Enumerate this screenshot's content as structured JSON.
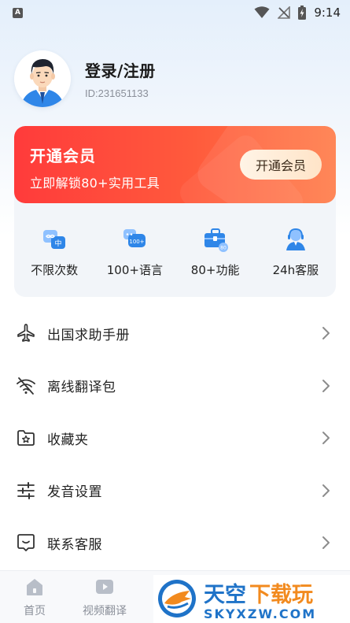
{
  "status_bar": {
    "left_icon": "A",
    "time": "9:14",
    "icons": [
      "wifi-icon",
      "no-signal-icon",
      "battery-charging-icon"
    ]
  },
  "profile": {
    "name": "登录/注册",
    "user_id": "ID:231651133",
    "avatar": "avatar-male-icon"
  },
  "vip": {
    "title": "开通会员",
    "subtitle": "立即解锁80+实用工具",
    "button_label": "开通会员",
    "gradient_start": "#ff3b3b",
    "gradient_end": "#ff7d4a",
    "features": [
      {
        "label": "不限次数",
        "icon": "infinity-translate-icon"
      },
      {
        "label": "100+语言",
        "icon": "language-chat-icon"
      },
      {
        "label": "80+功能",
        "icon": "toolbox-icon"
      },
      {
        "label": "24h客服",
        "icon": "customer-service-icon"
      }
    ]
  },
  "menu": [
    {
      "label": "出国求助手册",
      "icon": "airplane-icon"
    },
    {
      "label": "离线翻译包",
      "icon": "offline-wifi-icon"
    },
    {
      "label": "收藏夹",
      "icon": "star-folder-icon"
    },
    {
      "label": "发音设置",
      "icon": "sliders-icon"
    },
    {
      "label": "联系客服",
      "icon": "chat-bubble-icon"
    }
  ],
  "tabs": [
    {
      "label": "首页",
      "icon": "home-icon"
    },
    {
      "label": "视频翻译",
      "icon": "video-icon"
    }
  ],
  "watermark": {
    "logo_text": "天空下载玩",
    "url_text": "SKYXZW.COM"
  }
}
